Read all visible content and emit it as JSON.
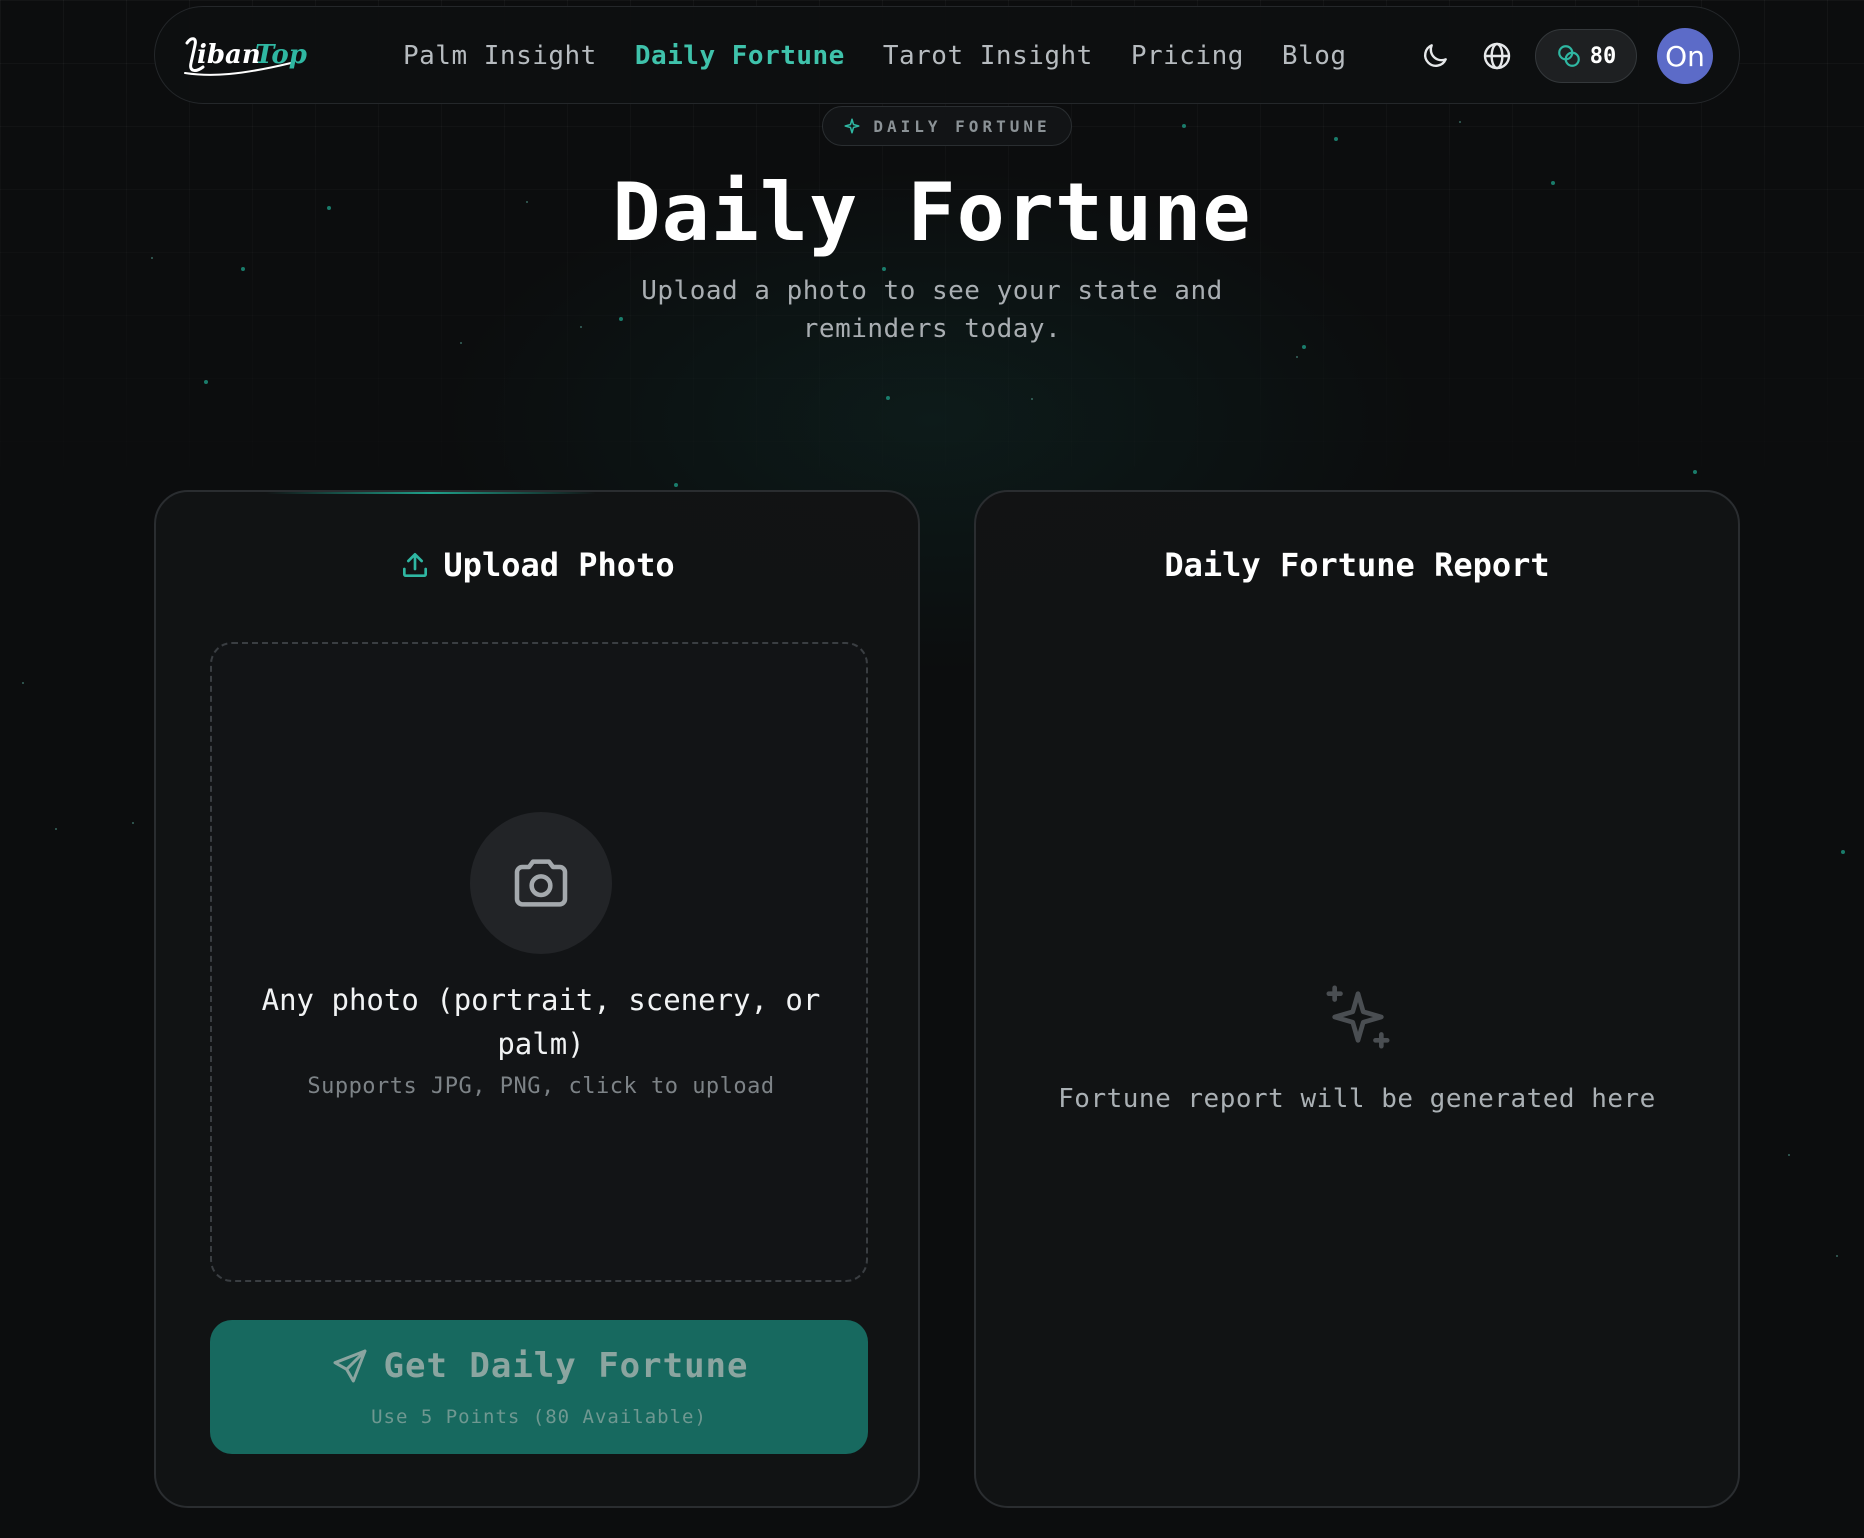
{
  "brand": {
    "logo_text": "YibanTop",
    "accent_color": "#1fa08a"
  },
  "nav": {
    "links": [
      {
        "label": "Palm Insight",
        "active": false
      },
      {
        "label": "Daily Fortune",
        "active": true
      },
      {
        "label": "Tarot Insight",
        "active": false
      },
      {
        "label": "Pricing",
        "active": false
      },
      {
        "label": "Blog",
        "active": false
      }
    ],
    "theme_icon": "moon-icon",
    "language_icon": "globe-icon",
    "points": "80",
    "points_icon": "coins-icon",
    "avatar_initials": "On",
    "avatar_color": "#5c6bc8"
  },
  "hero": {
    "badge": "DAILY FORTUNE",
    "badge_icon": "sparkles-icon",
    "title": "Daily Fortune",
    "subtitle": "Upload a photo to see your state and reminders today."
  },
  "upload_card": {
    "title": "Upload Photo",
    "title_icon": "upload-icon",
    "dropzone_icon": "camera-icon",
    "dropzone_main": "Any photo (portrait, scenery, or palm)",
    "dropzone_sub": "Supports JPG, PNG, click to upload",
    "button_label": "Get Daily Fortune",
    "button_icon": "send-icon",
    "button_sub": "Use 5 Points (80 Available)"
  },
  "report_card": {
    "title": "Daily Fortune Report",
    "empty_icon": "sparkles-icon",
    "empty_text": "Fortune report will be generated here"
  }
}
